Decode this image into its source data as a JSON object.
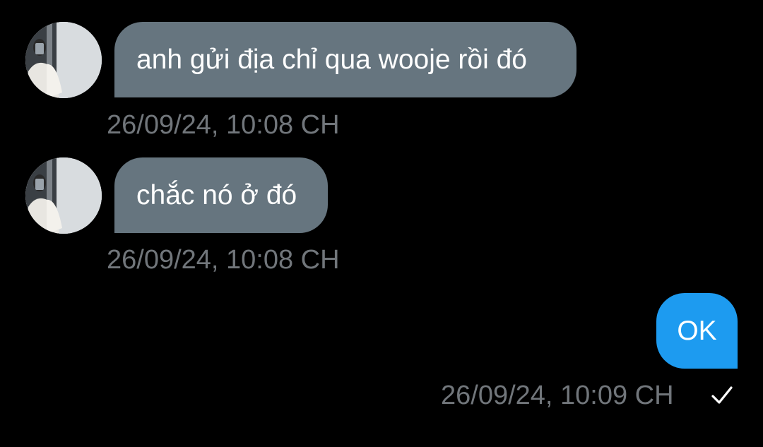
{
  "conversation": {
    "messages": [
      {
        "direction": "incoming",
        "text": "anh gửi địa chỉ qua wooje rồi đó",
        "timestamp": "26/09/24, 10:08 CH",
        "avatar_icon": "user-avatar-photo"
      },
      {
        "direction": "incoming",
        "text": "chắc nó ở đó",
        "timestamp": "26/09/24, 10:08 CH",
        "avatar_icon": "user-avatar-photo"
      },
      {
        "direction": "outgoing",
        "text": "OK",
        "timestamp": "26/09/24, 10:09 CH",
        "status_icon": "check-icon"
      }
    ]
  },
  "colors": {
    "background": "#000000",
    "incoming_bubble": "#66757f",
    "outgoing_bubble": "#1d9bf0",
    "timestamp_text": "#71767b",
    "bubble_text": "#ffffff"
  }
}
